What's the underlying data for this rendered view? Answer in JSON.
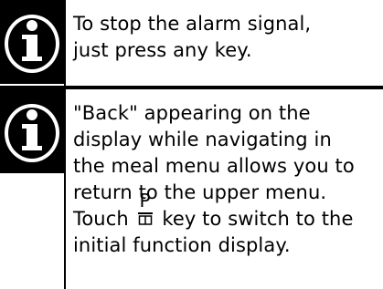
{
  "notices": [
    {
      "icon": "info-icon",
      "lines": [
        "To stop the alarm signal,",
        "just press any key."
      ]
    },
    {
      "icon": "info-icon",
      "lines": [
        "\"Back\" appearing on the",
        "display while navigating in",
        "the meal menu allows you to",
        "return to the upper menu."
      ],
      "key_sentence": {
        "before": "Touch ",
        "key_letter": "P",
        "key_icon": "program-key-icon",
        "after": " key to switch to the",
        "line2": "initial function display."
      }
    }
  ]
}
